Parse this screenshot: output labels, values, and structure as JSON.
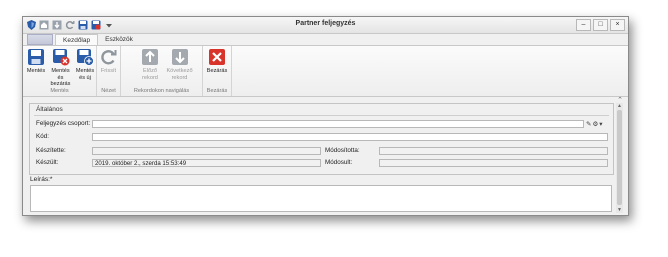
{
  "window": {
    "title": "Partner feljegyzés"
  },
  "tabs": [
    {
      "label": "Kezdőlap"
    },
    {
      "label": "Eszközök"
    }
  ],
  "ribbon": {
    "groups": [
      {
        "label": "Mentés",
        "buttons": [
          {
            "label_line1": "Mentés",
            "label_line2": "",
            "icon": "save-icon"
          },
          {
            "label_line1": "Mentés és",
            "label_line2": "bezárás",
            "icon": "save-close-icon"
          },
          {
            "label_line1": "Mentés",
            "label_line2": "és új",
            "icon": "save-new-icon"
          }
        ]
      },
      {
        "label": "Nézet",
        "buttons": [
          {
            "label_line1": "Frissít",
            "label_line2": "",
            "icon": "refresh-icon"
          }
        ]
      },
      {
        "label": "Rekordokon navigálás",
        "buttons": [
          {
            "label_line1": "Előző",
            "label_line2": "rekord",
            "icon": "arrow-up-icon"
          },
          {
            "label_line1": "Következő",
            "label_line2": "rekord",
            "icon": "arrow-down-icon"
          }
        ]
      },
      {
        "label": "Bezárás",
        "buttons": [
          {
            "label_line1": "Bezárás",
            "label_line2": "",
            "icon": "close-icon"
          }
        ]
      }
    ]
  },
  "form": {
    "section_title": "Általános",
    "feljegyzes_csoport": {
      "label": "Feljegyzés csoport:",
      "value": ""
    },
    "kod": {
      "label": "Kód:",
      "value": ""
    },
    "keszitette": {
      "label": "Készítette:",
      "value": ""
    },
    "modositotta": {
      "label": "Módosította:",
      "value": ""
    },
    "keszult": {
      "label": "Készült:",
      "value": "2019. október 2., szerda 15:53:49"
    },
    "modosult": {
      "label": "Módosult:",
      "value": ""
    },
    "leiras": {
      "label": "Leírás:*",
      "value": ""
    }
  },
  "colors": {
    "save_blue": "#2a5caa",
    "close_red": "#d9342b",
    "disabled_gray": "#9a9a9a"
  }
}
